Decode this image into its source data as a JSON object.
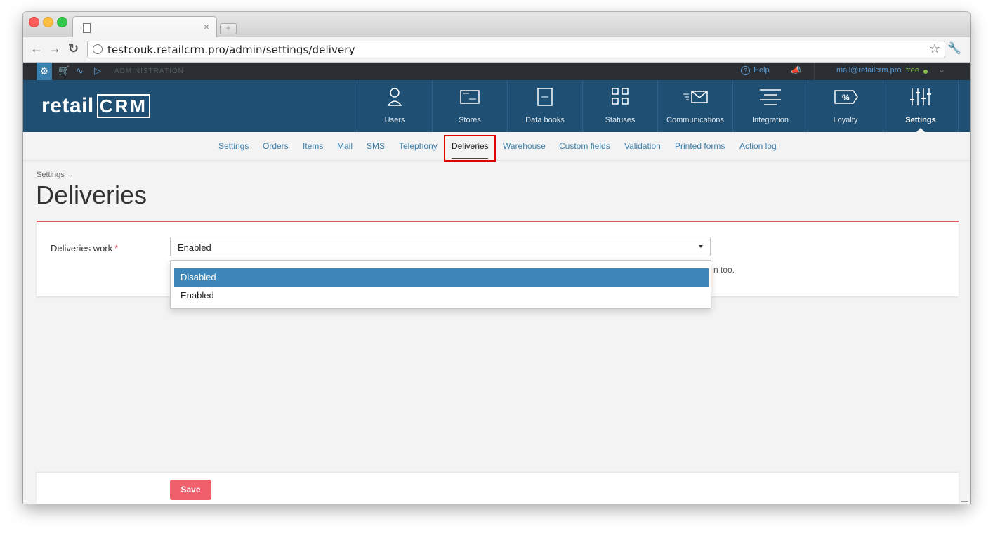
{
  "browser": {
    "url": "testcouk.retailcrm.pro/admin/settings/delivery",
    "tab_close": "×",
    "new_tab": "+"
  },
  "adminbar": {
    "label": "ADMINISTRATION",
    "help": "Help",
    "email": "mail@retailcrm.pro",
    "plan": "free"
  },
  "logo": {
    "retail": "retail",
    "crm": "CRM"
  },
  "mainnav": [
    {
      "label": "Users"
    },
    {
      "label": "Stores"
    },
    {
      "label": "Data books"
    },
    {
      "label": "Statuses"
    },
    {
      "label": "Communications"
    },
    {
      "label": "Integration"
    },
    {
      "label": "Loyalty"
    },
    {
      "label": "Settings"
    }
  ],
  "subnav": [
    {
      "label": "Settings"
    },
    {
      "label": "Orders"
    },
    {
      "label": "Items"
    },
    {
      "label": "Mail"
    },
    {
      "label": "SMS"
    },
    {
      "label": "Telephony"
    },
    {
      "label": "Deliveries"
    },
    {
      "label": "Warehouse"
    },
    {
      "label": "Custom fields"
    },
    {
      "label": "Validation"
    },
    {
      "label": "Printed forms"
    },
    {
      "label": "Action log"
    }
  ],
  "page": {
    "breadcrumb": "Settings →",
    "title": "Deliveries"
  },
  "form": {
    "field_label": "Deliveries work",
    "required_mark": "*",
    "selected_value": "Enabled",
    "hint_visible": "n too.",
    "options": [
      "Disabled",
      "Enabled"
    ],
    "save_label": "Save"
  },
  "colors": {
    "header": "#1f4f73",
    "accent_blue": "#3d87b8",
    "save_red": "#ef5f6c",
    "highlight_red": "#e00000"
  }
}
